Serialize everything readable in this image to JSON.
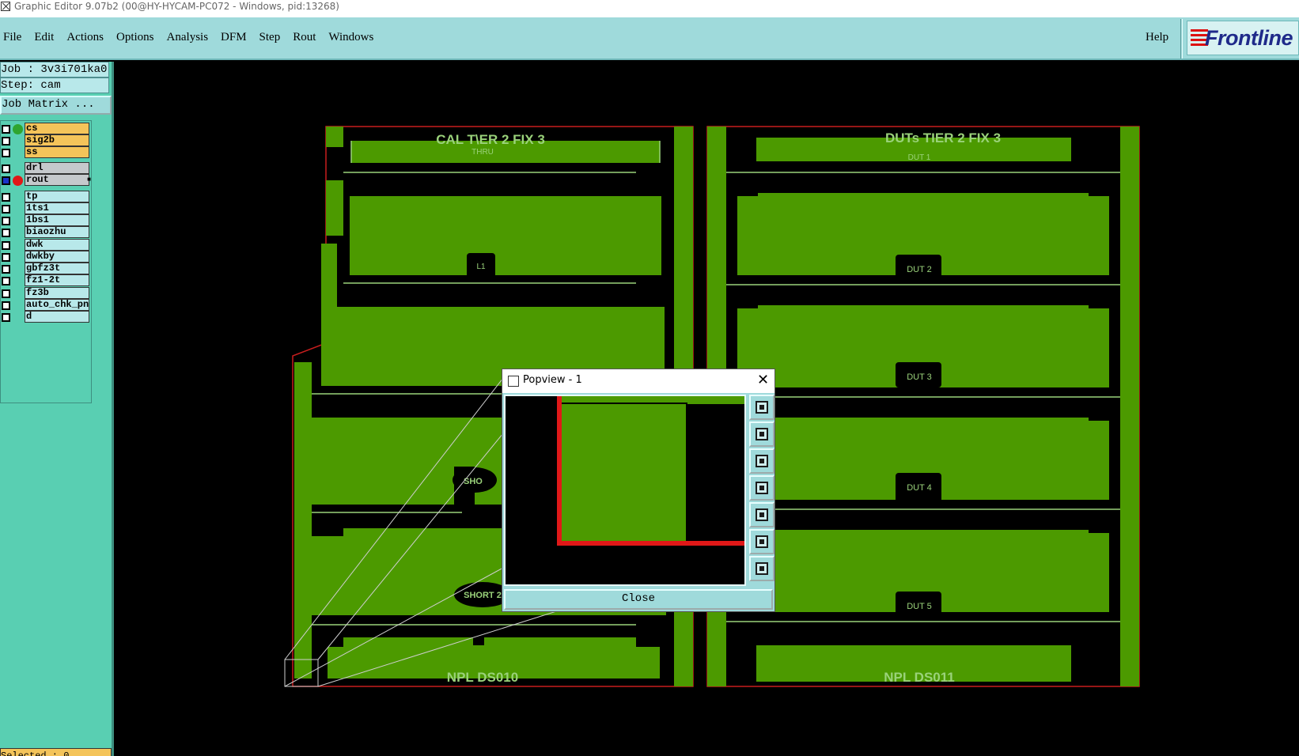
{
  "window": {
    "title": "Graphic Editor 9.07b2 (00@HY-HYCAM-PC072 - Windows, pid:13268)"
  },
  "menubar": {
    "items": [
      "File",
      "Edit",
      "Actions",
      "Options",
      "Analysis",
      "DFM",
      "Step",
      "Rout",
      "Windows"
    ],
    "help": "Help",
    "logo": "Frontline"
  },
  "left_panel": {
    "job": "Job : 3v3i701ka0",
    "step": "Step: cam",
    "job_matrix": "Job Matrix ...",
    "layers": [
      {
        "name": "cs",
        "checked": false,
        "color": "#f4c45a",
        "dot": "#2fa52f"
      },
      {
        "name": "sig2b",
        "checked": false,
        "color": "#f4c45a",
        "dot": ""
      },
      {
        "name": "ss",
        "checked": false,
        "color": "#f4c45a",
        "dot": ""
      },
      {
        "name": "drl",
        "checked": false,
        "color": "#c5c9cc",
        "dot": ""
      },
      {
        "name": "rout",
        "checked": true,
        "color": "#c5c9cc",
        "dot": "#e01818"
      },
      {
        "name": "tp",
        "checked": false,
        "color": "#b8e8ea",
        "dot": ""
      },
      {
        "name": "1ts1",
        "checked": false,
        "color": "#b8e8ea",
        "dot": ""
      },
      {
        "name": "1bs1",
        "checked": false,
        "color": "#b8e8ea",
        "dot": ""
      },
      {
        "name": "biaozhu",
        "checked": false,
        "color": "#b8e8ea",
        "dot": ""
      },
      {
        "name": "dwk",
        "checked": false,
        "color": "#b8e8ea",
        "dot": ""
      },
      {
        "name": "dwkby",
        "checked": false,
        "color": "#b8e8ea",
        "dot": ""
      },
      {
        "name": "gbfz3t",
        "checked": false,
        "color": "#b8e8ea",
        "dot": ""
      },
      {
        "name": "fz1-2t",
        "checked": false,
        "color": "#b8e8ea",
        "dot": ""
      },
      {
        "name": "fz3b",
        "checked": false,
        "color": "#b8e8ea",
        "dot": ""
      },
      {
        "name": "auto_chk_pn",
        "checked": false,
        "color": "#b8e8ea",
        "dot": ""
      },
      {
        "name": "d",
        "checked": false,
        "color": "#b8e8ea",
        "dot": ""
      }
    ],
    "selected": "Selected : 0"
  },
  "board": {
    "left_title": "CAL T\\ER 2 FIX 3",
    "left_sub": "THRU",
    "right_title": "DUTs TIER 2 FIX 3",
    "left_labels": [
      "L1",
      "SHO",
      "SHORT 2"
    ],
    "dut_labels": [
      "DUT 1",
      "DUT 2",
      "DUT 3",
      "DUT 4",
      "DUT 5"
    ],
    "left_bottom": "NPL DS010",
    "right_bottom": "NPL DS011",
    "colors": {
      "copper": "#4c9a00",
      "outline": "#c81e1e",
      "trace": "#9ad27a",
      "label": "#9ad27a"
    }
  },
  "popview": {
    "title": "Popview - 1",
    "close_label": "Close",
    "tools": [
      "zoom-fit-icon",
      "pan-up-icon",
      "pan-down-icon",
      "pan-left-icon",
      "pan-right-icon",
      "zoom-in-icon",
      "zoom-out-icon"
    ]
  }
}
